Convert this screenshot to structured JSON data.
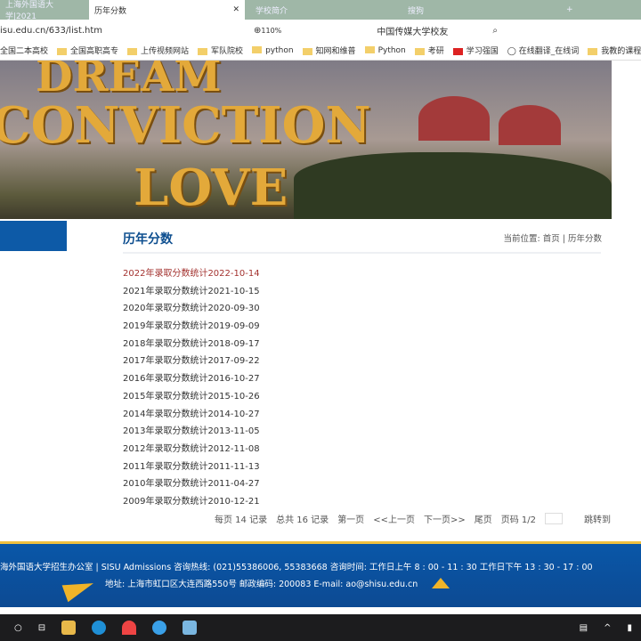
{
  "browser": {
    "tabs": [
      {
        "label": "上海外国语大学|2021"
      },
      {
        "label": "历年分数",
        "active": true
      },
      {
        "label": "学校简介"
      },
      {
        "label": "搜狗"
      }
    ],
    "url": "isu.edu.cn/633/list.htm",
    "zoom": "110%",
    "search_text": "中国传媒大学校友",
    "bookmarks": [
      "全国二本高校",
      "全国高职高专",
      "上传视频网站",
      "军队院校",
      "python",
      "知网和维普",
      "Python",
      "考研",
      "学习强国",
      "在线翻译_在线词",
      "我教的课程和"
    ]
  },
  "banner": {
    "words": [
      "DREAM",
      "CONVICTION",
      "LOVE"
    ]
  },
  "page": {
    "title": "历年分数",
    "breadcrumb_label": "当前位置:",
    "breadcrumb_home": "首页",
    "breadcrumb_sep": "|",
    "breadcrumb_current": "历年分数",
    "items": [
      "2022年录取分数统计2022-10-14",
      "2021年录取分数统计2021-10-15",
      "2020年录取分数统计2020-09-30",
      "2019年录取分数统计2019-09-09",
      "2018年录取分数统计2018-09-17",
      "2017年录取分数统计2017-09-22",
      "2016年录取分数统计2016-10-27",
      "2015年录取分数统计2015-10-26",
      "2014年录取分数统计2014-10-27",
      "2013年录取分数统计2013-11-05",
      "2012年录取分数统计2012-11-08",
      "2011年录取分数统计2011-11-13",
      "2010年录取分数统计2011-04-27",
      "2009年录取分数统计2010-12-21"
    ],
    "pager": {
      "per_page": "每页 14 记录",
      "total": "总共 16 记录",
      "first": "第一页",
      "prev": "<<上一页",
      "next": "下一页>>",
      "last": "尾页",
      "page": "页码 1/2",
      "jump": "跳转到"
    }
  },
  "footer": {
    "line1": "海外国语大学招生办公室 | SISU Admissions 咨询热线: (021)55386006, 55383668 咨询时间: 工作日上午 8 : 00 - 11 : 30 工作日下午 13 : 30 - 17 : 00",
    "line2": "地址: 上海市虹口区大连西路550号 邮政编码: 200083 E-mail: ao@shisu.edu.cn"
  }
}
